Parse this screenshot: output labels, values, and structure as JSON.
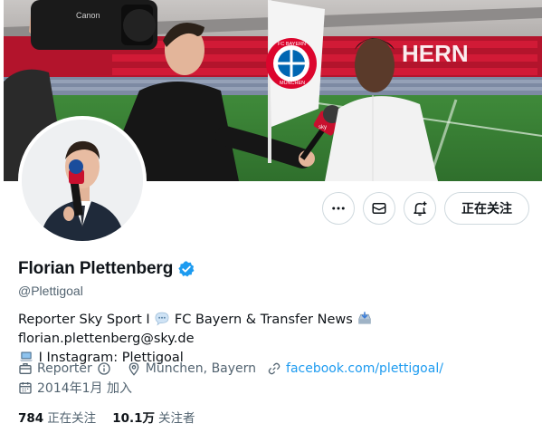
{
  "profile": {
    "display_name": "Florian Plettenberg",
    "handle": "@Plettigoal",
    "verified": true
  },
  "actions": {
    "more_icon": "more-horizontal-icon",
    "message_icon": "envelope-icon",
    "notify_icon": "bell-plus-icon",
    "follow_label": "正在关注"
  },
  "bio": {
    "part1": "Reporter Sky Sport I ",
    "part2": " FC Bayern & Transfer News ",
    "part3": "florian.plettenberg@sky.de",
    "part4": " I Instagram: Plettigoal",
    "emoji1": "speech-balloon-icon",
    "emoji2": "inbox-tray-icon",
    "emoji3": "laptop-icon"
  },
  "meta": {
    "category": "Reporter",
    "location": "München, Bayern",
    "website": "facebook.com/plettigoal/",
    "joined": "2014年1月 加入"
  },
  "stats": {
    "following_count": "784",
    "following_label": "正在关注",
    "followers_count": "10.1万",
    "followers_label": "关注者"
  },
  "banner": {
    "flag_text_top": "FC BAYERN",
    "flag_text_bottom": "MÜNCHEN",
    "stand_letters": "HERN",
    "camera_brand": "Canon",
    "mic_brand": "sky"
  },
  "colors": {
    "accent": "#1d9bf0",
    "verified": "#1d9bf0",
    "bayern_red": "#dc052d",
    "border": "#cfd9de"
  }
}
